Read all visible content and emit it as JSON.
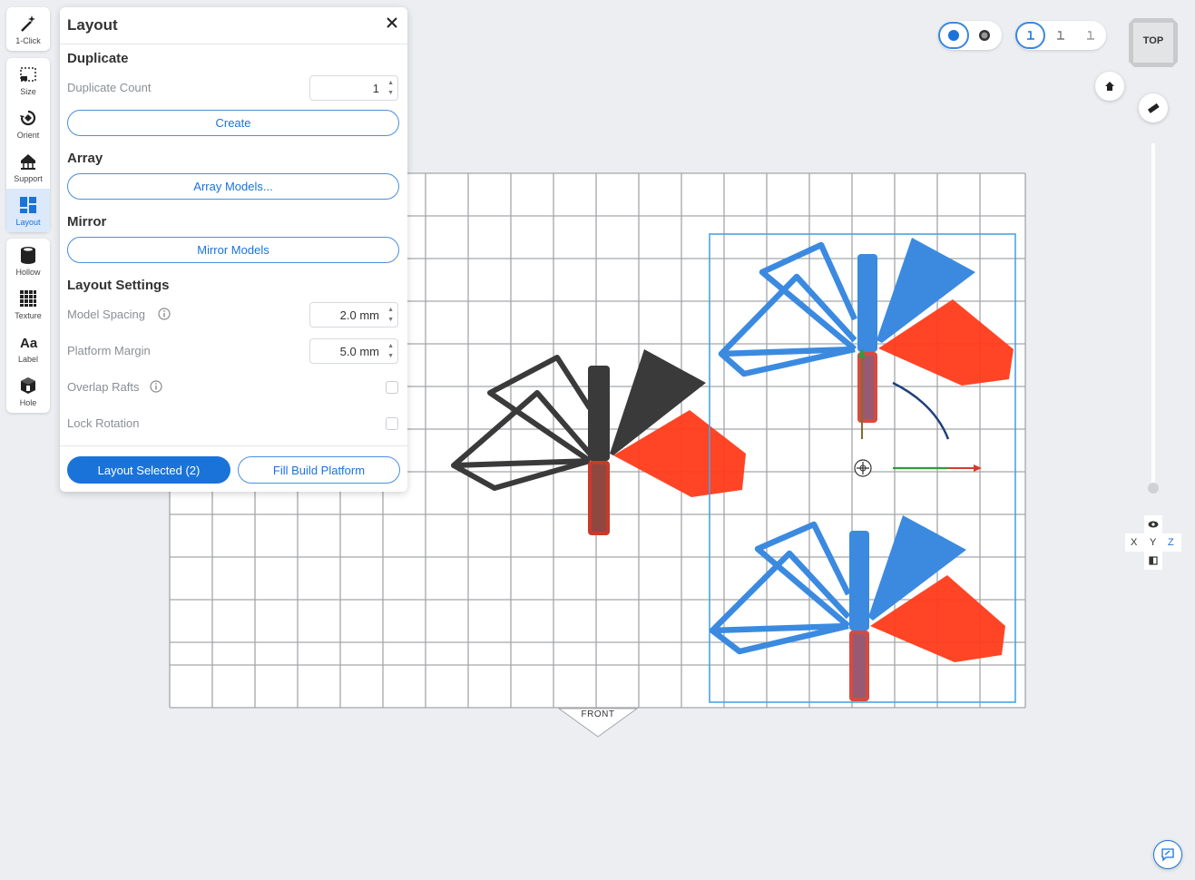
{
  "toolbar": {
    "one_click": "1-Click",
    "size": "Size",
    "orient": "Orient",
    "support": "Support",
    "layout": "Layout",
    "hollow": "Hollow",
    "texture": "Texture",
    "label": "Label",
    "hole": "Hole"
  },
  "panel": {
    "title": "Layout",
    "duplicate": {
      "title": "Duplicate",
      "count_label": "Duplicate Count",
      "count_value": "1",
      "create_label": "Create"
    },
    "array": {
      "title": "Array",
      "button_label": "Array Models..."
    },
    "mirror": {
      "title": "Mirror",
      "button_label": "Mirror Models"
    },
    "settings": {
      "title": "Layout Settings",
      "model_spacing_label": "Model Spacing",
      "model_spacing_value": "2.0 mm",
      "platform_margin_label": "Platform Margin",
      "platform_margin_value": "5.0 mm",
      "overlap_rafts_label": "Overlap Rafts",
      "overlap_rafts_checked": false,
      "lock_rotation_label": "Lock Rotation",
      "lock_rotation_checked": false
    },
    "layout_selected_label": "Layout Selected (2)",
    "fill_platform_label": "Fill Build Platform"
  },
  "viewport": {
    "view_cube_label": "TOP",
    "front_label": "FRONT",
    "axes": {
      "x": "X",
      "y": "Y",
      "z": "Z"
    },
    "colors": {
      "selected_model": "#3b8ae0",
      "unselected_model": "#3a3a3a",
      "support_highlight": "#ff3b1a",
      "accent": "#1a73d9"
    }
  }
}
